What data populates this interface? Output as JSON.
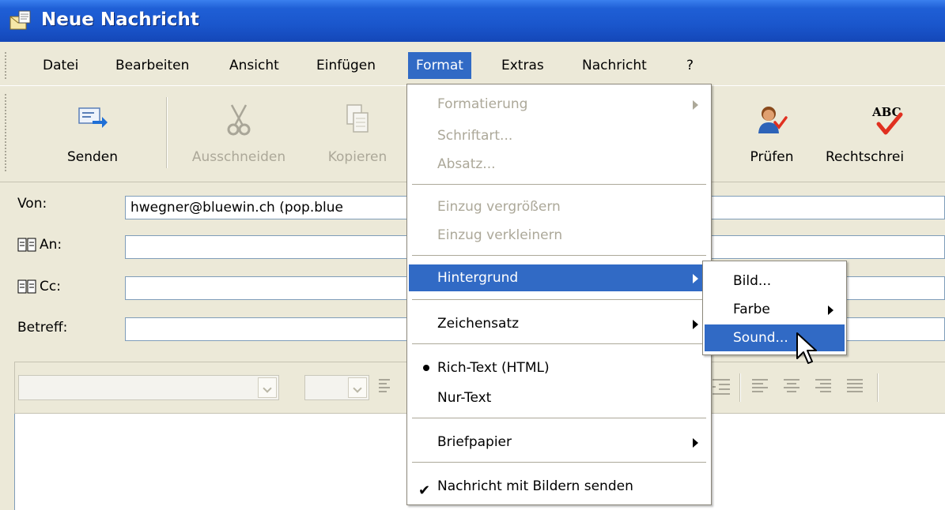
{
  "window": {
    "title": "Neue Nachricht"
  },
  "menubar": {
    "items": [
      "Datei",
      "Bearbeiten",
      "Ansicht",
      "Einfügen",
      "Format",
      "Extras",
      "Nachricht",
      "?"
    ]
  },
  "toolbar": {
    "send": "Senden",
    "cut": "Ausschneiden",
    "copy": "Kopieren",
    "check": "Prüfen",
    "spelling": "Rechtschrei"
  },
  "header": {
    "from_label": "Von:",
    "from_value": "hwegner@bluewin.ch    (pop.blue",
    "to_label": "An:",
    "cc_label": "Cc:",
    "subject_label": "Betreff:"
  },
  "format_menu": {
    "formatting": "Formatierung",
    "font": "Schriftart...",
    "paragraph": "Absatz...",
    "indent_increase": "Einzug vergrößern",
    "indent_decrease": "Einzug verkleinern",
    "background": "Hintergrund",
    "charset": "Zeichensatz",
    "rich_text": "Rich-Text (HTML)",
    "plain_text": "Nur-Text",
    "stationery": "Briefpapier",
    "send_pictures": "Nachricht mit Bildern senden"
  },
  "background_submenu": {
    "picture": "Bild...",
    "color": "Farbe",
    "sound": "Sound..."
  },
  "colors": {
    "titlebar": "#1f5fd6",
    "highlight": "#316ac5",
    "face": "#ece9d8",
    "disabled": "#aca899"
  }
}
